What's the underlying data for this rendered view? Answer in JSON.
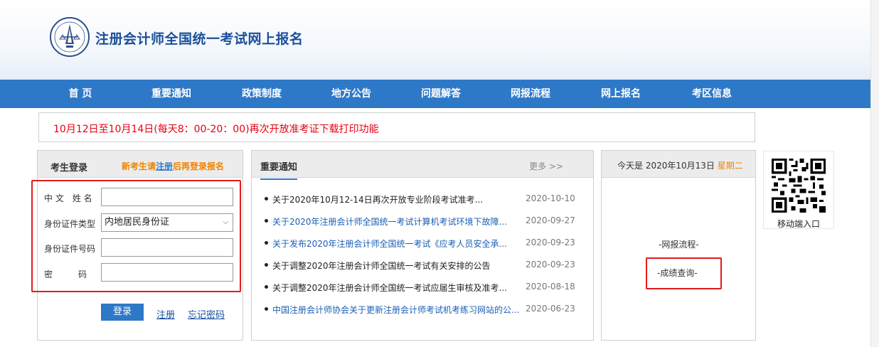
{
  "header": {
    "site_title": "注册会计师全国统一考试网上报名"
  },
  "nav": {
    "items": [
      "首 页",
      "重要通知",
      "政策制度",
      "地方公告",
      "问题解答",
      "网报流程",
      "网上报名",
      "考区信息"
    ]
  },
  "notice": {
    "text": "10月12日至10月14日(每天8：00-20：00)再次开放准考证下载打印功能"
  },
  "login": {
    "title": "考生登录",
    "hint_prefix": "新考生请",
    "hint_link": "注册",
    "hint_suffix": "后再登录报名",
    "fields": {
      "name_label": "中 文　姓 名",
      "id_type_label": "身份证件类型",
      "id_type_value": "内地居民身份证",
      "id_number_label": "身份证件号码",
      "password_label": "密　　　码"
    },
    "login_button": "登录",
    "register_link": "注册",
    "forgot_link": "忘记密码"
  },
  "news": {
    "tab_title": "重要通知",
    "more": "更多 >>",
    "items": [
      {
        "title": "关于2020年10月12-14日再次开放专业阶段考试准考...",
        "date": "2020-10-10"
      },
      {
        "title": "关于2020年注册会计师全国统一考试计算机考试环境下故障...",
        "date": "2020-09-27"
      },
      {
        "title": "关于发布2020年注册会计师全国统一考试《应考人员安全承...",
        "date": "2020-09-23"
      },
      {
        "title": "关于调整2020年注册会计师全国统一考试有关安排的公告",
        "date": "2020-09-23"
      },
      {
        "title": "关于调整2020年注册会计师全国统一考试应届生审核及准考...",
        "date": "2020-08-18"
      },
      {
        "title": "中国注册会计师协会关于更新注册会计师考试机考练习网站的公...",
        "date": "2020-06-23"
      }
    ]
  },
  "date_panel": {
    "prefix": "今天是 2020年10月13日",
    "weekday": "星期二",
    "flow_link": "-网报流程-",
    "score_link": "-成绩查询-"
  },
  "qr": {
    "label": "移动端入口",
    "icon": "qr-code-icon"
  },
  "colors": {
    "nav_blue": "#2e78c8",
    "notice_red": "#e60012",
    "hint_orange": "#f08300",
    "highlight_red": "#e21c1c",
    "title_blue": "#1b4f9c"
  }
}
